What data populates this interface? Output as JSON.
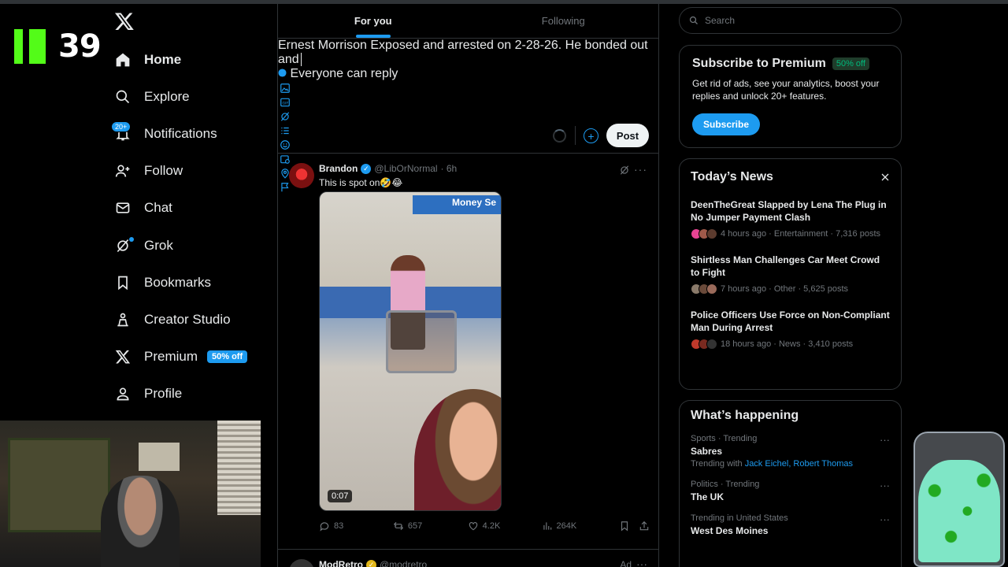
{
  "overlay": {
    "counter": "39"
  },
  "sidebar": {
    "items": [
      {
        "label": "Home",
        "icon": "home-icon"
      },
      {
        "label": "Explore",
        "icon": "search-icon"
      },
      {
        "label": "Notifications",
        "icon": "bell-icon",
        "badge": "20+"
      },
      {
        "label": "Follow",
        "icon": "add-person-icon"
      },
      {
        "label": "Chat",
        "icon": "mail-icon"
      },
      {
        "label": "Grok",
        "icon": "grok-icon"
      },
      {
        "label": "Bookmarks",
        "icon": "bookmark-icon"
      },
      {
        "label": "Creator Studio",
        "icon": "creator-studio-icon"
      },
      {
        "label": "Premium",
        "icon": "x-logo-icon",
        "pill": "50% off"
      },
      {
        "label": "Profile",
        "icon": "person-icon"
      }
    ]
  },
  "tabs": [
    {
      "label": "For you"
    },
    {
      "label": "Following"
    }
  ],
  "composer": {
    "text": "Ernest Morrison Exposed and arrested on 2-28-26. He bonded out and",
    "reply_setting": "Everyone can reply",
    "post_label": "Post"
  },
  "tweet": {
    "name": "Brandon",
    "handle": "@LibOrNormal",
    "time": "· 6h",
    "body": "This is spot on🤣😂",
    "video_duration": "0:07",
    "video_sign": "Money Se",
    "replies": "83",
    "reposts": "657",
    "likes": "4.2K",
    "views": "264K"
  },
  "tweet2": {
    "name": "ModRetro",
    "handle": "@modretro",
    "ad": "Ad"
  },
  "search": {
    "placeholder": "Search"
  },
  "premium": {
    "title": "Subscribe to Premium",
    "discount": "50% off",
    "desc": "Get rid of ads, see your analytics, boost your replies and unlock 20+ features.",
    "button": "Subscribe"
  },
  "news": {
    "title": "Today’s News",
    "items": [
      {
        "headline": "DeenTheGreat Slapped by Lena The Plug in No Jumper Payment Clash",
        "meta": "4 hours ago · Entertainment · 7,316 posts"
      },
      {
        "headline": "Shirtless Man Challenges Car Meet Crowd to Fight",
        "meta": "7 hours ago · Other · 5,625 posts"
      },
      {
        "headline": "Police Officers Use Force on Non-Compliant Man During Arrest",
        "meta": "18 hours ago · News · 3,410 posts"
      }
    ]
  },
  "happening": {
    "title": "What’s happening",
    "trends": [
      {
        "context": "Sports · Trending",
        "topic": "Sabres",
        "with_label": "Trending with",
        "with_links": "Jack Eichel, Robert Thomas"
      },
      {
        "context": "Politics · Trending",
        "topic": "The UK"
      },
      {
        "context": "Trending in United States",
        "topic": "West Des Moines"
      }
    ]
  },
  "colors": {
    "accent": "#1d9bf0",
    "background": "#000000",
    "kick_green": "#53fc18"
  }
}
